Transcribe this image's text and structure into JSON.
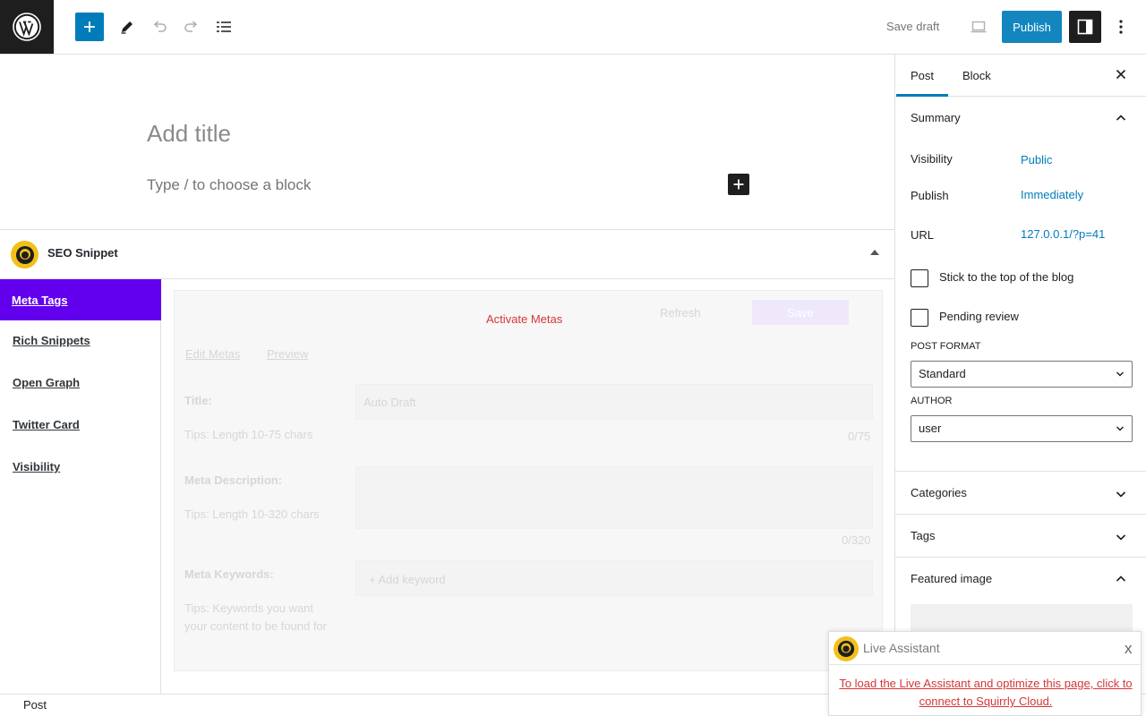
{
  "topbar": {
    "save_draft": "Save draft",
    "publish": "Publish"
  },
  "editor": {
    "title_placeholder": "Add title",
    "block_placeholder": "Type / to choose a block"
  },
  "seo": {
    "title": "SEO Snippet",
    "nav": [
      "Meta Tags",
      "Rich Snippets",
      "Open Graph",
      "Twitter Card",
      "Visibility"
    ],
    "activate": "Activate Metas",
    "refresh": "Refresh",
    "save": "Save",
    "tabs": [
      "Edit Metas",
      "Preview"
    ],
    "title_label": "Title:",
    "title_placeholder": "Auto Draft",
    "title_tip": "Tips: Length 10-75 chars",
    "title_count": "0/75",
    "desc_label": "Meta Description:",
    "desc_tip": "Tips: Length 10-320 chars",
    "desc_count": "0/320",
    "kw_label": "Meta Keywords:",
    "kw_placeholder": "+ Add keyword",
    "kw_tip_line1": "Tips: Keywords you want",
    "kw_tip_line2": "your content to be found for"
  },
  "sidebar": {
    "tabs": [
      "Post",
      "Block"
    ],
    "summary": "Summary",
    "visibility_label": "Visibility",
    "visibility_value": "Public",
    "publish_label": "Publish",
    "publish_value": "Immediately",
    "url_label": "URL",
    "url_value": "127.0.0.1/?p=41",
    "stick_label": "Stick to the top of the blog",
    "pending_label": "Pending review",
    "post_format_label": "POST FORMAT",
    "post_format_value": "Standard",
    "author_label": "AUTHOR",
    "author_value": "user",
    "categories": "Categories",
    "tags": "Tags",
    "featured_image": "Featured image"
  },
  "footer": {
    "breadcrumb": "Post"
  },
  "assistant": {
    "title": "Live Assistant",
    "close": "x",
    "link": "To load the Live Assistant and optimize this page, click to connect to Squirrly Cloud."
  },
  "colors": {
    "accent": "#007cba",
    "seo_active": "#6200ee",
    "warning_red": "#d63638",
    "squirrly_yellow": "#f2c018"
  },
  "icons": [
    "wordpress-icon",
    "plus-icon",
    "pencil-icon",
    "undo-icon",
    "redo-icon",
    "list-view-icon",
    "laptop-preview-icon",
    "sidebar-toggle-icon",
    "more-options-icon",
    "close-icon",
    "chevron-up-icon",
    "chevron-down-icon",
    "squirrly-logo-icon"
  ]
}
